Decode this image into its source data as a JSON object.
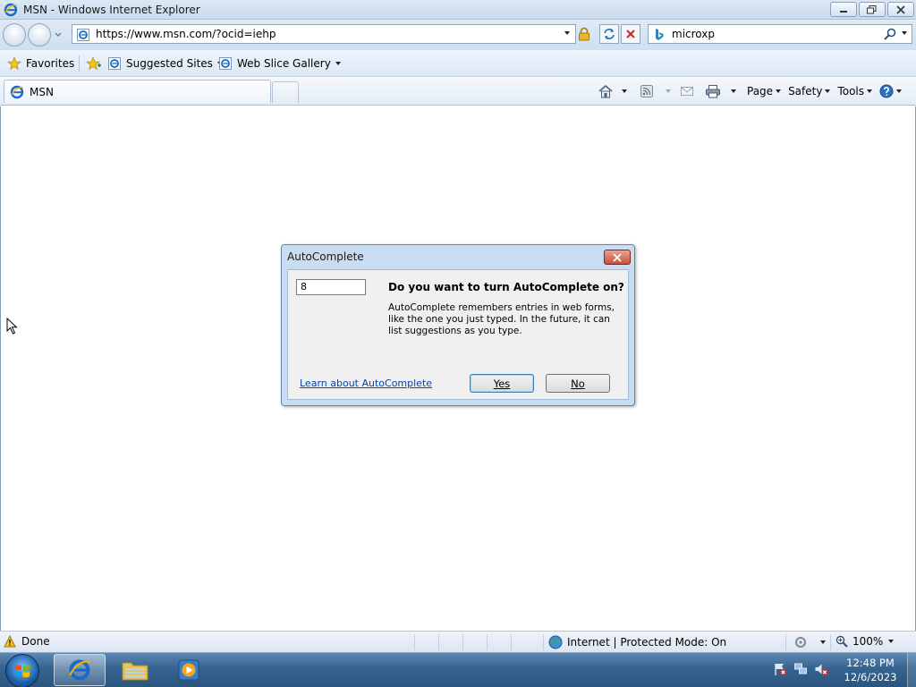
{
  "window": {
    "title": "MSN - Windows Internet Explorer"
  },
  "address": {
    "url": "https://www.msn.com/?ocid=iehp"
  },
  "search": {
    "query": "microxp"
  },
  "favorites_bar": {
    "favorites_label": "Favorites",
    "suggested_sites_label": "Suggested Sites",
    "web_slice_gallery_label": "Web Slice Gallery"
  },
  "tabs": [
    {
      "label": "MSN",
      "active": true
    }
  ],
  "command_bar": {
    "page_label": "Page",
    "safety_label": "Safety",
    "tools_label": "Tools"
  },
  "dialog": {
    "title": "AutoComplete",
    "input_value": "8",
    "question": "Do you want to turn AutoComplete on?",
    "description": "AutoComplete remembers entries in web forms, like the one you just typed. In the future, it can list suggestions as you type.",
    "link_text": "Learn about AutoComplete",
    "yes_label": "Yes",
    "no_label": "No"
  },
  "status_bar": {
    "status_text": "Done",
    "zone_text": "Internet | Protected Mode: On",
    "zoom_text": "100%"
  },
  "taskbar": {
    "time": "12:48 PM",
    "date": "12/6/2023"
  },
  "icons": {
    "title_icon": "ie-icon",
    "lock": "lock-icon",
    "search_engine": "bing-icon",
    "home": "home-icon",
    "feeds": "rss-icon",
    "mail": "mail-icon",
    "print": "printer-icon",
    "help": "help-icon"
  },
  "colors": {
    "chrome_blue": "#cfdff1",
    "link_blue": "#0645ad",
    "close_red": "#c7503b",
    "taskbar_blue": "#35638f"
  }
}
